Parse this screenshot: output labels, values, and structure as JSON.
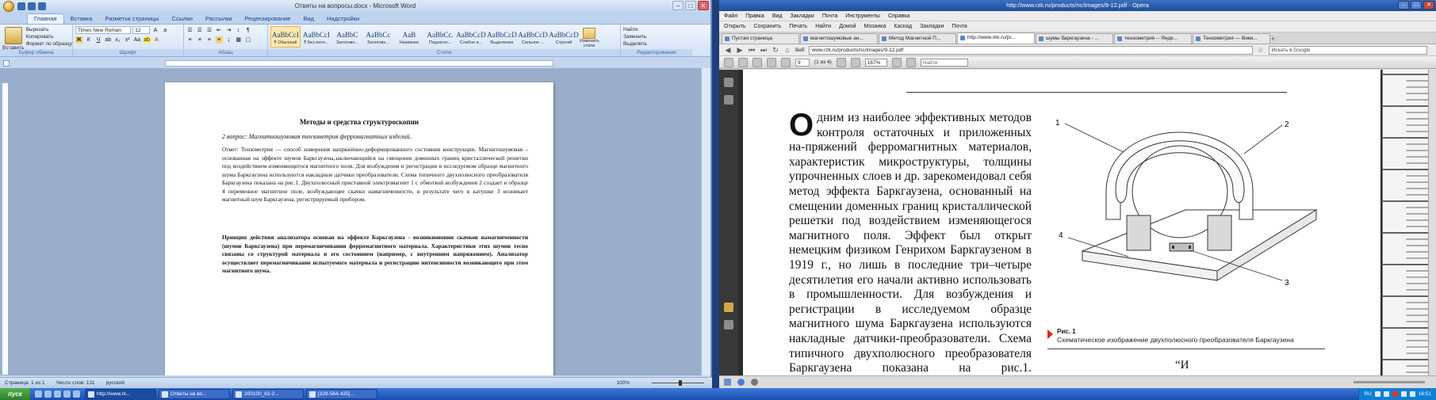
{
  "word": {
    "title": "Ответы на вопросы.docx - Microsoft Word",
    "tabs": [
      "Главная",
      "Вставка",
      "Разметка страницы",
      "Ссылки",
      "Рассылки",
      "Рецензирование",
      "Вид",
      "Надстройки"
    ],
    "clipboard": {
      "paste": "Вставить",
      "cut": "Вырезать",
      "copy": "Копировать",
      "format": "Формат по образцу",
      "label": "Буфер обмена"
    },
    "font": {
      "name": "Times New Roman",
      "size": "12",
      "label": "Шрифт"
    },
    "paragraph_label": "Абзац",
    "styles": [
      {
        "preview": "AaBbCcI",
        "name": "¶ Обычный"
      },
      {
        "preview": "AaBbCcI",
        "name": "¶ Без инте..."
      },
      {
        "preview": "AaBbC",
        "name": "Заголово..."
      },
      {
        "preview": "AaBbCc",
        "name": "Заголово..."
      },
      {
        "preview": "AaB",
        "name": "Название"
      },
      {
        "preview": "AaBbCc.",
        "name": "Подзагол..."
      },
      {
        "preview": "AaBbCcD",
        "name": "Слабое в..."
      },
      {
        "preview": "AaBbCcD",
        "name": "Выделение"
      },
      {
        "preview": "AaBbCcD",
        "name": "Сильное ..."
      },
      {
        "preview": "AaBbCcD",
        "name": "Строгий"
      }
    ],
    "styles_label": "Стили",
    "change_styles": "Изменить стили",
    "editing": {
      "find": "Найти",
      "replace": "Заменить",
      "select": "Выделить",
      "label": "Редактирование"
    },
    "doc": {
      "title": "Методы и средства структуроскопии",
      "question": "2 вопрос: Магнитношумовая тензометрия ферромагнитных изделий.",
      "answer1": "Ответ: Тензометрия — способ измерения напряжённо-деформированного состояния конструкции. Магнитошумовая – основанная на эффекте шумов Баркгаузена,заключающийся на смещении доменных границ кристаллической решетки под воздействием изменяющегося магнитного поля. Для возбуждения и регистрации в исследуемом образце магнитного шума Баркгаузена используются накладные датчики преобразователи. Схема типичного двухполюсного преобразователя Баркгаузена показана на рис.1. Двухполюсный приставной электромагнит 1 с обмоткой возбуждения 2 создает в образце 4 переменное магнитное поле, возбуждающее скачки намагниченности, в результате чего в катушке 3 возникает магнитный шум Баркгаузена, регистрируемый прибором.",
      "answer2": "Принцип действия анализатора основан на эффекте Баркгаузена - возникновении скачков намагниченности (шумов Баркгаузена) при перемагничивании ферромагнитного материала. Характеристики этих шумов тесно связаны со структурой материала и его состоянием (например, с внутренним напряжением). Анализатор осуществляет перемагничивание испытуемого материала и регистрацию интенсивности возникающего при этом магнитного шума."
    },
    "status": {
      "page": "Страница: 1 из 1",
      "words": "Число слов: 131",
      "lang": "русский",
      "zoom": "100%"
    }
  },
  "opera": {
    "title": "http://www.rzk.ru/products/nc/images/9-12.pdf - Opera",
    "menu": [
      "Файл",
      "Правка",
      "Вид",
      "Закладки",
      "Почта",
      "Инструменты",
      "Справка"
    ],
    "toolbar": [
      "Открыть",
      "Сохранить",
      "Печать",
      "Найти",
      "Домой",
      "Мозаика",
      "Каскад",
      "Закладки",
      "Почта"
    ],
    "tabs": [
      "Пустая страница",
      "магнитошумовые ан...",
      "Метод Магнитной П...",
      "http://www.rkk.ru/pr...",
      "шумы баркгаузена - ...",
      "тензометрия -- Яндe...",
      "Тензометрия — Вики..."
    ],
    "active_tab": 3,
    "address": "www.rzk.ru/products/nc/images/9-12.pdf",
    "address_prefix": "Веб",
    "search_placeholder": "Искать в Google",
    "pdf": {
      "page": "9",
      "of": "(1 из 4)",
      "zoom": "167%",
      "find": "Найти"
    },
    "article_dropcap": "О",
    "article_text": "дним из наиболее эффективных методов контроля остаточных и приложенных на-пряжений ферромагнитных материалов, характеристик микроструктуры, толщины упрочненных слоев и др. зарекомендовал себя метод эффекта Баркгаузена, основанный на смещении доменных границ кристаллической решетки под воздействием изменяющегося магнитного поля. Эффект был открыт немецким физиком Генрихом Баркгаузеном в 1919 г., но лишь в последние три–четыре десятилетия его начали активно использовать в промышленности. Для возбуждения и регистрации в исследуемом образце магнитного шума Баркгаузена используются накладные датчики-преобразователи. Схема типичного двухполюсного преобразователя Баркгаузена показана на рис.1. Двухполюсный",
    "figure": {
      "labels": [
        "1",
        "2",
        "3",
        "4"
      ],
      "caption_title": "Рис. 1",
      "caption": "Схематическое изображение двухполюсного преобразователя Баркгаузена",
      "trailing": "“И"
    }
  },
  "taskbar": {
    "start": "пуск",
    "items": [
      "http://www.rk...",
      "Ответы на во...",
      "200100_62-2...",
      "[329-564-425]..."
    ],
    "tray_lang": "RU",
    "clock": "16:51"
  },
  "colors": {
    "word_accent": "#15428b",
    "opera_title": "#1f4c9c",
    "taskbar": "#1a4db0",
    "figure_caption_mark": "#d9261c"
  }
}
